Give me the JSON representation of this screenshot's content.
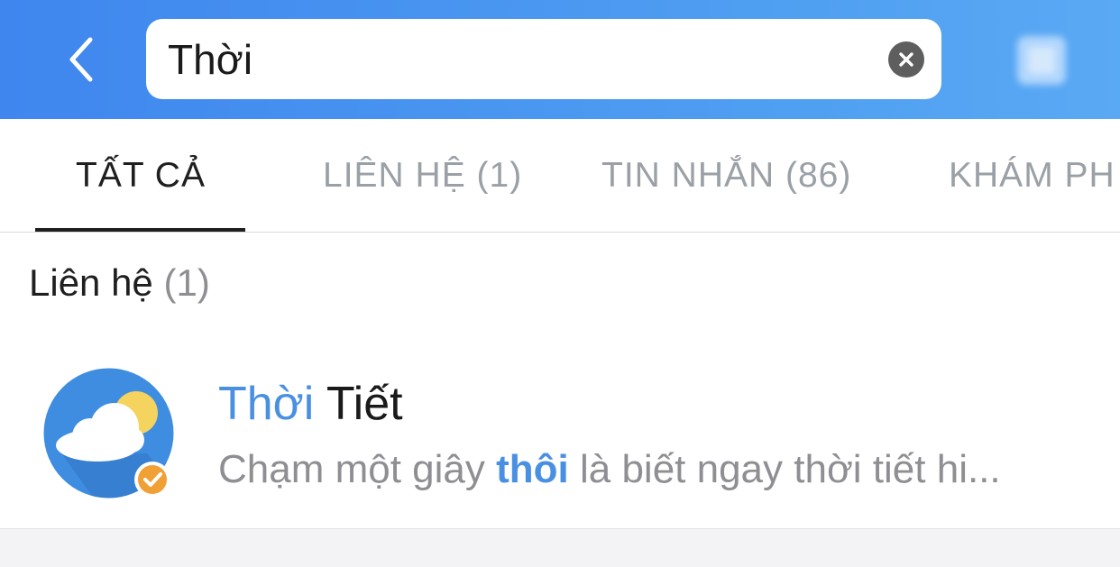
{
  "header": {
    "back_icon": "chevron-left-icon",
    "search": {
      "value": "Thời",
      "clear_icon": "close-circle-icon"
    },
    "qr_icon": "qr-scan-icon",
    "gradient_start": "#3f86ee",
    "gradient_end": "#5aa9f4"
  },
  "tabs": [
    {
      "label": "TẤT CẢ",
      "active": true
    },
    {
      "label": "LIÊN HỆ (1)",
      "active": false
    },
    {
      "label": "TIN NHẮN (86)",
      "active": false
    },
    {
      "label": "KHÁM PH",
      "active": false
    }
  ],
  "section": {
    "title": "Liên hệ",
    "count": "(1)"
  },
  "results": [
    {
      "name_highlight": "Thời",
      "name_rest": " Tiết",
      "desc_before": "Chạm một giây ",
      "desc_keyword": "thôi",
      "desc_after": " là biết ngay thời tiết hi...",
      "avatar_icon": "weather-cloud-sun-icon",
      "badge_icon": "verified-badge-icon"
    }
  ],
  "colors": {
    "accent": "#4a90e2",
    "badge": "#f0a035",
    "text_primary": "#1f1f1f",
    "text_secondary": "#8e8e93"
  }
}
